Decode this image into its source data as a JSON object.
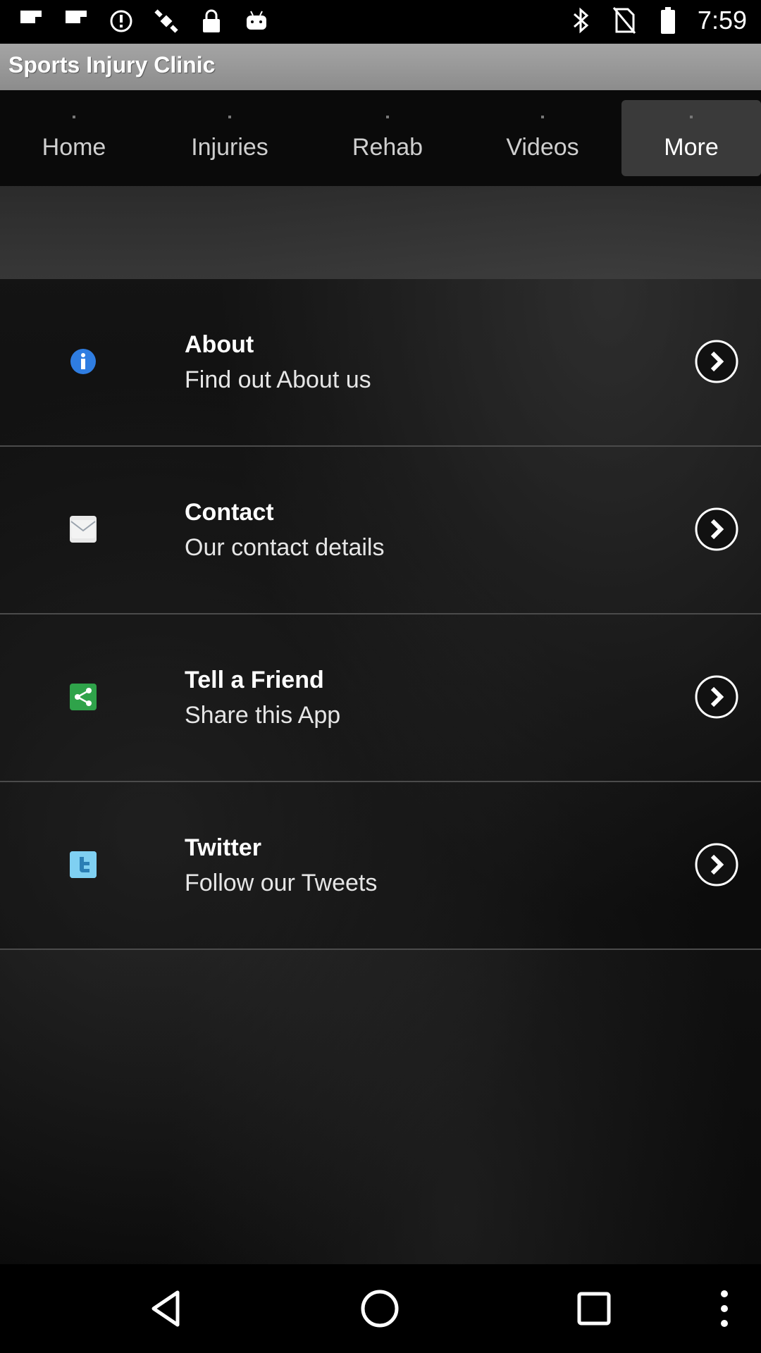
{
  "status_bar": {
    "time": "7:59",
    "left_icons": [
      "flipboard-icon",
      "flipboard-icon",
      "alert-circle-icon",
      "satellite-icon",
      "lock-icon",
      "android-icon"
    ],
    "right_icons": [
      "bluetooth-icon",
      "no-sim-icon",
      "battery-icon"
    ]
  },
  "app": {
    "title": "Sports Injury Clinic"
  },
  "tabs": [
    {
      "label": "Home",
      "active": false
    },
    {
      "label": "Injuries",
      "active": false
    },
    {
      "label": "Rehab",
      "active": false
    },
    {
      "label": "Videos",
      "active": false
    },
    {
      "label": "More",
      "active": true
    }
  ],
  "menu": {
    "items": [
      {
        "title": "About",
        "subtitle": "Find out About us",
        "icon": "info-icon",
        "icon_color": "#2f7de1"
      },
      {
        "title": "Contact",
        "subtitle": "Our contact details",
        "icon": "mail-icon",
        "icon_color": "#e8e8e8"
      },
      {
        "title": "Tell a Friend",
        "subtitle": "Share this App",
        "icon": "share-icon",
        "icon_color": "#2fa34a"
      },
      {
        "title": "Twitter",
        "subtitle": "Follow our Tweets",
        "icon": "twitter-icon",
        "icon_color": "#5bc0ea"
      }
    ]
  },
  "nav_bar": {
    "buttons": [
      "back-icon",
      "home-icon",
      "recents-icon",
      "overflow-menu-icon"
    ]
  }
}
